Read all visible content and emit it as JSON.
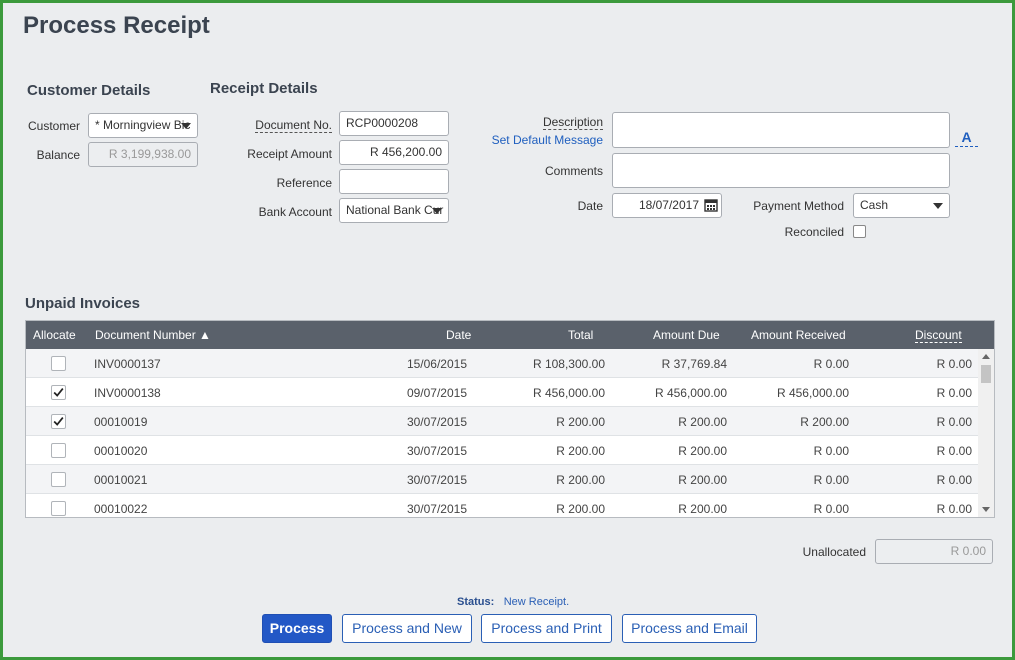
{
  "page": {
    "title": "Process Receipt"
  },
  "customer_details": {
    "title": "Customer Details",
    "customer_label": "Customer",
    "customer_value": "* Morningview Bic",
    "balance_label": "Balance",
    "balance_value": "R 3,199,938.00"
  },
  "receipt_details": {
    "title": "Receipt Details",
    "document_no_label": "Document No.",
    "document_no_value": "RCP0000208",
    "receipt_amount_label": "Receipt Amount",
    "receipt_amount_value": "R 456,200.00",
    "reference_label": "Reference",
    "reference_value": "",
    "bank_account_label": "Bank Account",
    "bank_account_value": "National Bank Cur"
  },
  "extra": {
    "description_label": "Description",
    "set_default_message": "Set Default Message",
    "description_value": "",
    "font_button": "A",
    "comments_label": "Comments",
    "comments_value": "",
    "date_label": "Date",
    "date_value": "18/07/2017",
    "payment_method_label": "Payment Method",
    "payment_method_value": "Cash",
    "reconciled_label": "Reconciled"
  },
  "invoices": {
    "title": "Unpaid Invoices",
    "columns": {
      "allocate": "Allocate",
      "document_number": "Document Number ▲",
      "date": "Date",
      "total": "Total",
      "amount_due": "Amount Due",
      "amount_received": "Amount Received",
      "discount": "Discount"
    },
    "rows": [
      {
        "checked": false,
        "doc": "INV0000137",
        "date": "15/06/2015",
        "total": "R 108,300.00",
        "due": "R 37,769.84",
        "received": "R 0.00",
        "discount": "R 0.00"
      },
      {
        "checked": true,
        "doc": "INV0000138",
        "date": "09/07/2015",
        "total": "R 456,000.00",
        "due": "R 456,000.00",
        "received": "R 456,000.00",
        "discount": "R 0.00"
      },
      {
        "checked": true,
        "doc": "00010019",
        "date": "30/07/2015",
        "total": "R 200.00",
        "due": "R 200.00",
        "received": "R 200.00",
        "discount": "R 0.00"
      },
      {
        "checked": false,
        "doc": "00010020",
        "date": "30/07/2015",
        "total": "R 200.00",
        "due": "R 200.00",
        "received": "R 0.00",
        "discount": "R 0.00"
      },
      {
        "checked": false,
        "doc": "00010021",
        "date": "30/07/2015",
        "total": "R 200.00",
        "due": "R 200.00",
        "received": "R 0.00",
        "discount": "R 0.00"
      },
      {
        "checked": false,
        "doc": "00010022",
        "date": "30/07/2015",
        "total": "R 200.00",
        "due": "R 200.00",
        "received": "R 0.00",
        "discount": "R 0.00"
      }
    ]
  },
  "unallocated": {
    "label": "Unallocated",
    "value": "R 0.00"
  },
  "status": {
    "label": "Status:",
    "value": "New Receipt."
  },
  "buttons": {
    "process": "Process",
    "process_new": "Process and New",
    "process_print": "Process and Print",
    "process_email": "Process and Email"
  }
}
